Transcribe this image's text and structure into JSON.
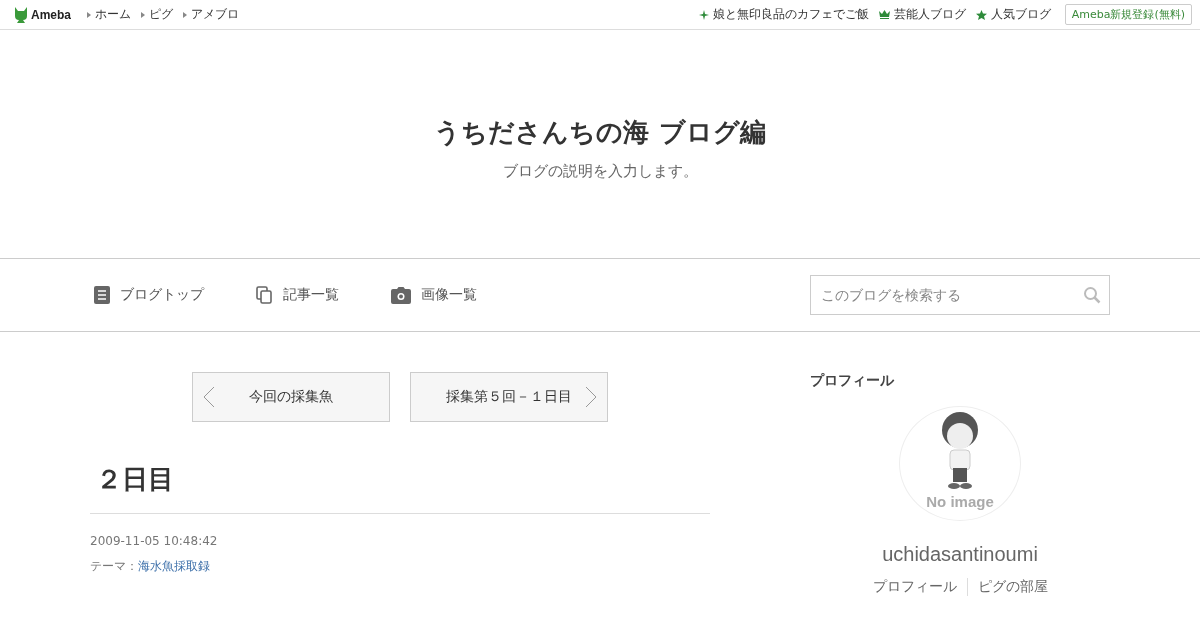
{
  "topbar": {
    "logo": "Ameba",
    "links": [
      "ホーム",
      "ピグ",
      "アメブロ"
    ],
    "right_links": [
      {
        "kind": "sparkle",
        "label": "娘と無印良品のカフェでご飯"
      },
      {
        "kind": "crown",
        "label": "芸能人ブログ"
      },
      {
        "kind": "star",
        "label": "人気ブログ"
      }
    ],
    "signup": "Ameba新規登録(無料)"
  },
  "header": {
    "title": "うちださんちの海 ブログ編",
    "description": "ブログの説明を入力します。"
  },
  "nav": {
    "items": [
      {
        "kind": "doc",
        "label": "ブログトップ"
      },
      {
        "kind": "pages",
        "label": "記事一覧"
      },
      {
        "kind": "camera",
        "label": "画像一覧"
      }
    ],
    "search": {
      "placeholder": "このブログを検索する"
    }
  },
  "pager": {
    "prev": "今回の採集魚",
    "next": "採集第５回－１日目"
  },
  "entry": {
    "title": "２日目",
    "date": "2009-11-05 10:48:42",
    "theme_label": "テーマ：",
    "theme": "海水魚採取録"
  },
  "profile": {
    "heading": "プロフィール",
    "avatar_caption": "No image",
    "name": "uchidasantinoumi",
    "links": [
      "プロフィール",
      "ピグの部屋"
    ]
  }
}
